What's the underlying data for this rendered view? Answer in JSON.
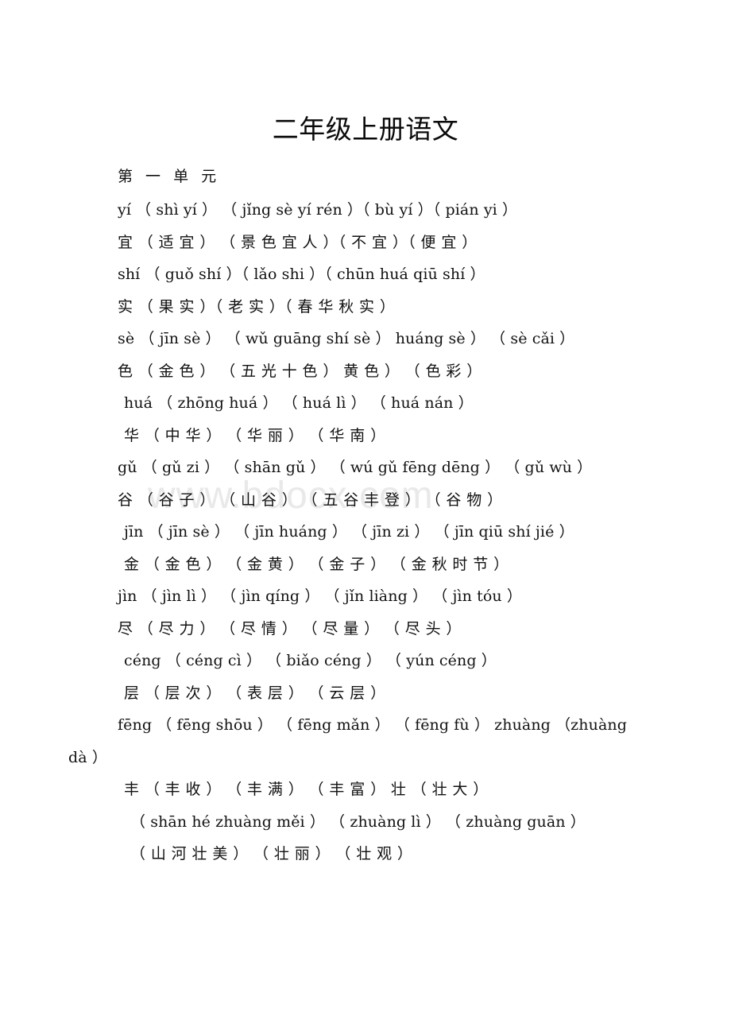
{
  "document": {
    "title": "二年级上册语文",
    "unit_label": "第 一 单 元",
    "watermark": "www.bdocx.com"
  },
  "lines": [
    {
      "id": "yi-pinyin",
      "type": "pinyin",
      "indent": 0,
      "text": "yí （ shì yí ） （ jǐng sè yí rén ）（ bù yí ）（ pián yi ）"
    },
    {
      "id": "yi-hanzi",
      "type": "hanzi",
      "indent": 0,
      "text": "宜 （ 适 宜 ） （ 景 色 宜 人 ）（ 不 宜 ）（ 便 宜 ）"
    },
    {
      "id": "shi-pinyin",
      "type": "pinyin",
      "indent": 0,
      "text": "shí （ guǒ shí ）（ lǎo shi ）（ chūn huá qiū shí ）"
    },
    {
      "id": "shi-hanzi",
      "type": "hanzi",
      "indent": 0,
      "text": "实 （ 果 实 ）（ 老 实 ）（ 春 华 秋 实 ）"
    },
    {
      "id": "se-pinyin",
      "type": "pinyin",
      "indent": 0,
      "text": "sè （ jīn sè ） （ wǔ guāng shí sè ） huáng sè ） （ sè cǎi ）"
    },
    {
      "id": "se-hanzi",
      "type": "hanzi",
      "indent": 0,
      "text": "色 （ 金 色 ） （ 五 光 十 色 ） 黄 色 ） （ 色 彩 ）"
    },
    {
      "id": "hua-pinyin",
      "type": "pinyin",
      "indent": 1,
      "text": "huá （ zhōng huá ） （ huá lì ） （ huá nán ）"
    },
    {
      "id": "hua-hanzi",
      "type": "hanzi",
      "indent": 1,
      "text": "华 （ 中 华 ） （ 华 丽 ） （ 华 南 ）"
    },
    {
      "id": "gu-pinyin",
      "type": "pinyin",
      "indent": 0,
      "text": "gǔ （ gǔ zi ） （ shān gǔ ） （ wú gǔ fēng dēng ） （ gǔ wù ）"
    },
    {
      "id": "gu-hanzi",
      "type": "hanzi",
      "indent": 0,
      "text": "谷 （ 谷 子 ） （ 山 谷 ） （ 五 谷 丰 登 ） （ 谷 物 ）"
    },
    {
      "id": "jin1-pinyin",
      "type": "pinyin",
      "indent": 1,
      "text": "jīn （ jīn sè ） （ jīn huáng ） （ jīn zi ） （ jīn qiū shí jié ）"
    },
    {
      "id": "jin1-hanzi",
      "type": "hanzi",
      "indent": 1,
      "text": "金 （ 金 色 ） （ 金 黄 ） （ 金 子 ） （ 金 秋 时 节 ）"
    },
    {
      "id": "jin2-pinyin",
      "type": "pinyin",
      "indent": 0,
      "text": "jìn （ jìn lì ） （ jìn qíng ） （ jǐn liàng ） （ jìn tóu ）"
    },
    {
      "id": "jin2-hanzi",
      "type": "hanzi",
      "indent": 0,
      "text": "尽 （ 尽 力 ） （ 尽 情 ） （ 尽 量 ） （ 尽 头 ）"
    },
    {
      "id": "ceng-pinyin",
      "type": "pinyin",
      "indent": 1,
      "text": "céng （ céng cì ） （ biǎo céng ） （ yún céng ）"
    },
    {
      "id": "ceng-hanzi",
      "type": "hanzi",
      "indent": 1,
      "text": "层 （ 层 次 ） （ 表 层 ） （ 云 层 ）"
    },
    {
      "id": "feng-pinyin",
      "type": "pinyin",
      "indent": 0,
      "text": "fēng （ fēng shōu ） （ fēng mǎn ） （ fēng fù ） zhuàng （zhuàng"
    },
    {
      "id": "feng-pinyin-2",
      "type": "pinyin",
      "indent": 0,
      "wrap_out": true,
      "text": "dà ）"
    },
    {
      "id": "feng-hanzi",
      "type": "hanzi",
      "indent": 1,
      "text": "丰 （ 丰 收 ） （ 丰 满 ） （ 丰 富 ） 壮 （ 壮 大 ）"
    },
    {
      "id": "zhuang-pinyin",
      "type": "pinyin",
      "indent": 2,
      "text": "（ shān hé zhuàng měi ） （ zhuàng lì ） （ zhuàng guān ）"
    },
    {
      "id": "zhuang-hanzi",
      "type": "hanzi",
      "indent": 2,
      "text": "（ 山 河 壮 美 ） （ 壮 丽 ） （ 壮 观 ）"
    }
  ]
}
